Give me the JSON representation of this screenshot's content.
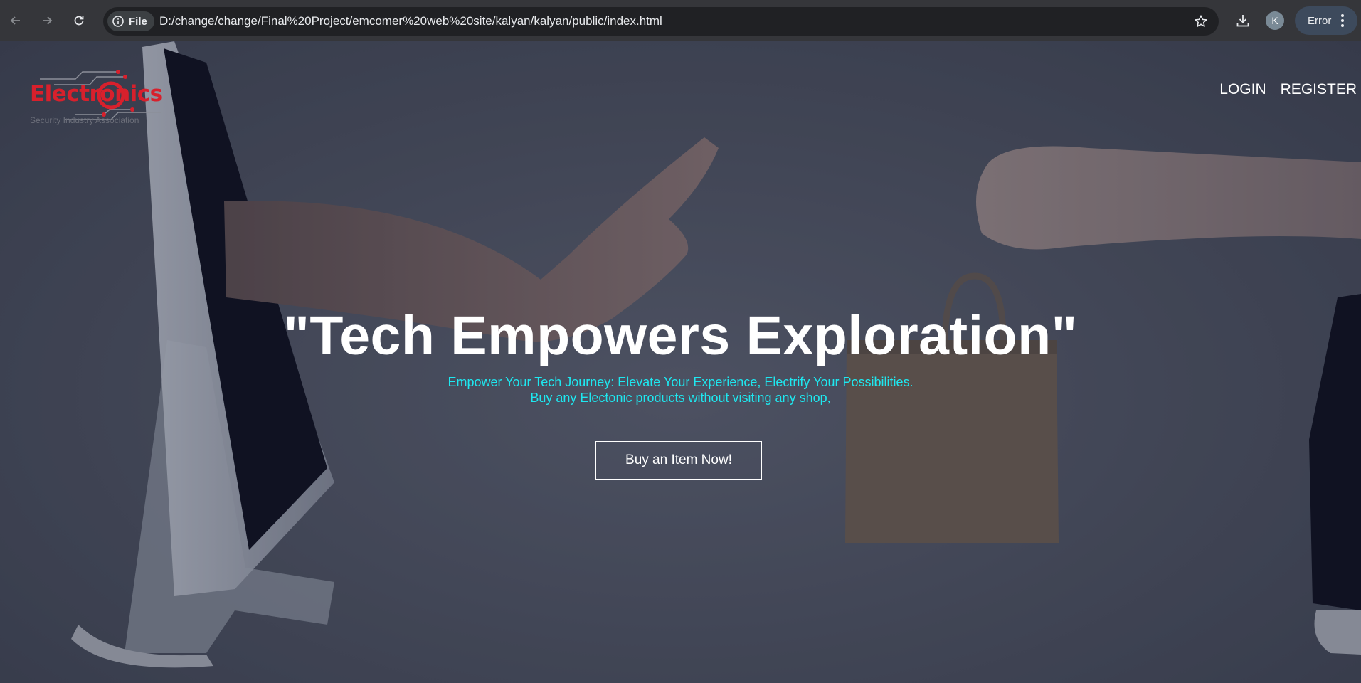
{
  "browser": {
    "site_chip_label": "File",
    "url": "D:/change/change/Final%20Project/emcomer%20web%20site/kalyan/kalyan/public/index.html",
    "profile_initial": "K",
    "error_label": "Error"
  },
  "site": {
    "logo_text": "Electronics",
    "logo_subtitle": "Security Industry Association",
    "nav": {
      "login": "LOGIN",
      "register": "REGISTER"
    },
    "hero": {
      "headline": "\"Tech Empowers Exploration\"",
      "subtitle_line1": "Empower Your Tech Journey: Elevate Your Experience, Electrify Your Possibilities.",
      "subtitle_line2": "Buy any Electonic products without visiting any shop,",
      "cta_label": "Buy an Item Now!"
    }
  },
  "colors": {
    "chrome_bg": "#35363a",
    "omnibox_bg": "#202124",
    "logo_red": "#d8202c",
    "subtitle_cyan": "#1ee8f0",
    "hero_text": "#ffffff"
  },
  "icons": {
    "back": "arrow-left-icon",
    "forward": "arrow-right-icon",
    "reload": "reload-icon",
    "info": "info-icon",
    "bookmark": "star-icon",
    "download": "download-icon",
    "menu": "kebab-menu-icon"
  }
}
